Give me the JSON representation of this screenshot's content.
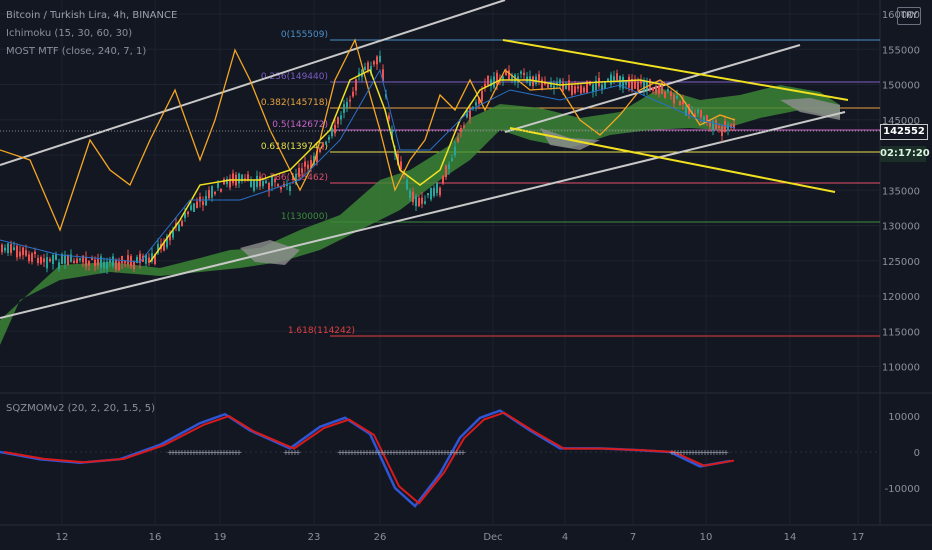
{
  "header": {
    "title": "Bitcoin / Turkish Lira, 4h, BINANCE",
    "ind1": "Ichimoku (15, 30, 60, 30)",
    "ind2": "MOST MTF (close, 240, 7, 1)",
    "currency_badge": "TRY"
  },
  "oscillator": {
    "label": "SQZMOMv2 (20, 2, 20, 1.5, 5)",
    "ticks": [
      "10000",
      "0",
      "-10000"
    ]
  },
  "price_axis": {
    "ticks": [
      "160000",
      "155000",
      "150000",
      "145000",
      "140000",
      "135000",
      "130000",
      "125000",
      "120000",
      "115000",
      "110000"
    ],
    "last_price": "142552",
    "countdown": "02:17:20"
  },
  "time_axis": {
    "labels": [
      "12",
      "16",
      "19",
      "23",
      "26",
      "Dec",
      "4",
      "7",
      "10",
      "14",
      "17"
    ]
  },
  "fib_levels": [
    {
      "label": "0(155509)",
      "color": "#4a90c8"
    },
    {
      "label": "0.236(149440)",
      "color": "#7c5cc4"
    },
    {
      "label": "0.382(145718)",
      "color": "#e8a23c"
    },
    {
      "label": "0.5(142672)",
      "color": "#c864c8"
    },
    {
      "label": "0.618(139747)",
      "color": "#e8e04a"
    },
    {
      "label": "0.786(135462)",
      "color": "#e0506a"
    },
    {
      "label": "1(130000)",
      "color": "#3c8c3c"
    },
    {
      "label": "1.618(114242)",
      "color": "#e04040"
    }
  ],
  "colors": {
    "background": "#131722",
    "grid": "#1e2230",
    "bull": "#26a69a",
    "bear": "#ef5350",
    "cloud_bull": "#3d8b37",
    "cloud_bear": "#8e8e8e",
    "channel": "#c8c8c8",
    "wedge": "#f0e020",
    "most_line": "#f5a623",
    "osc_blue": "#2f55d4",
    "osc_red": "#d81a1a"
  }
}
